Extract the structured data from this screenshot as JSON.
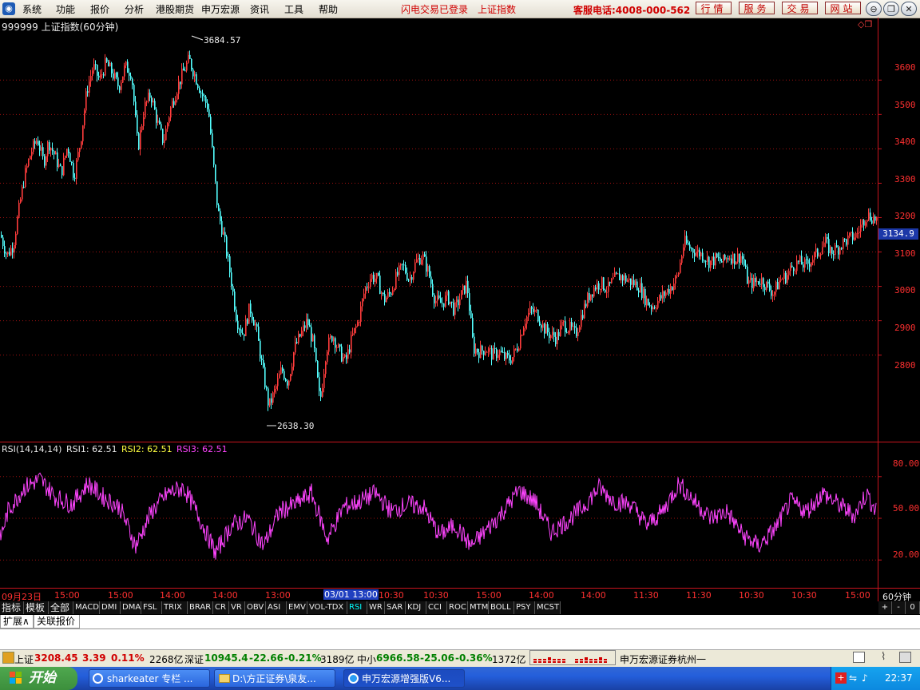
{
  "menu": {
    "items": [
      "系统",
      "功能",
      "报价",
      "分析",
      "港股期货",
      "申万宏源",
      "资讯",
      "工具",
      "帮助"
    ],
    "notice_login": "闪电交易已登录",
    "notice_index": "上证指数",
    "hotline": "客服电话:4008-000-562",
    "service_buttons": [
      "行情",
      "服务",
      "交易",
      "网站"
    ]
  },
  "chart_header": {
    "title": "999999 上证指数(60分钟)"
  },
  "main_axis": {
    "ticks": [
      "3600",
      "3500",
      "3400",
      "3300",
      "3200",
      "3100",
      "3000",
      "2900",
      "2800"
    ],
    "current_price": "3134.9"
  },
  "annotations": {
    "high": "3684.57",
    "low": "2638.30"
  },
  "indicator": {
    "name": "RSI(14,14,14)",
    "rsi1": "RSI1: 62.51",
    "rsi2": "RSI2: 62.51",
    "rsi3": "RSI3: 62.51",
    "ticks": [
      "80.00",
      "50.00",
      "20.00"
    ]
  },
  "time_axis": {
    "labels": [
      "09月23日",
      "15:00",
      "15:00",
      "14:00",
      "14:00",
      "13:00",
      "03/01 13:00",
      "10:30",
      "10:30",
      "15:00",
      "14:00",
      "14:00",
      "11:30",
      "11:30",
      "10:30",
      "10:30",
      "15:00"
    ],
    "period": "60分钟"
  },
  "indicator_tabs": [
    "指标",
    "模板",
    "全部",
    "MACD",
    "DMI",
    "DMA",
    "FSL",
    "TRIX",
    "BRAR",
    "CR",
    "VR",
    "OBV",
    "ASI",
    "EMV",
    "VOL-TDX",
    "RSI",
    "WR",
    "SAR",
    "KDJ",
    "CCI",
    "ROC",
    "MTM",
    "BOLL",
    "PSY",
    "MCST"
  ],
  "tab_controls": [
    "+",
    "-",
    "0"
  ],
  "extension_tabs": [
    "扩展∧",
    "关联报价"
  ],
  "status": {
    "sh_label": "上证",
    "sh_value": "3208.45",
    "sh_change": "3.39",
    "sh_pct": "0.11%",
    "sh_amount": "2268亿",
    "sz_label": "深证",
    "sz_value": "10945.4",
    "sz_change": "-22.66",
    "sz_pct": "-0.21%",
    "sz_amount": "3189亿",
    "zx_label": "中小",
    "zx_value": "6966.58",
    "zx_change": "-25.06",
    "zx_pct": "-0.36%",
    "zx_amount": "1372亿",
    "broker": "申万宏源证券杭州一"
  },
  "taskbar": {
    "start": "开始",
    "tasks": [
      "sharkeater 专栏 ...",
      "D:\\方正证券\\泉友...",
      "申万宏源增强版V6..."
    ],
    "clock": "22:37"
  },
  "colors": {
    "up": "#ff3c3c",
    "down": "#54ffff",
    "rsi": "#ff44ff",
    "grid": "#a01010",
    "axis": "#c8141e"
  },
  "chart_data": {
    "type": "candlestick",
    "title": "999999 上证指数(60分钟)",
    "y_range": [
      2560,
      3740
    ],
    "high": 3684.57,
    "low": 2638.3,
    "last": 3134.9,
    "close_path": [
      [
        0,
        3150
      ],
      [
        8,
        3090
      ],
      [
        16,
        3120
      ],
      [
        22,
        3210
      ],
      [
        30,
        3320
      ],
      [
        38,
        3390
      ],
      [
        46,
        3430
      ],
      [
        54,
        3360
      ],
      [
        60,
        3420
      ],
      [
        68,
        3380
      ],
      [
        76,
        3330
      ],
      [
        84,
        3410
      ],
      [
        92,
        3320
      ],
      [
        100,
        3420
      ],
      [
        108,
        3570
      ],
      [
        116,
        3640
      ],
      [
        124,
        3600
      ],
      [
        132,
        3650
      ],
      [
        140,
        3620
      ],
      [
        148,
        3580
      ],
      [
        156,
        3640
      ],
      [
        164,
        3620
      ],
      [
        172,
        3400
      ],
      [
        180,
        3520
      ],
      [
        188,
        3560
      ],
      [
        196,
        3480
      ],
      [
        204,
        3420
      ],
      [
        212,
        3510
      ],
      [
        220,
        3570
      ],
      [
        228,
        3620
      ],
      [
        236,
        3660
      ],
      [
        244,
        3610
      ],
      [
        252,
        3560
      ],
      [
        260,
        3520
      ],
      [
        266,
        3370
      ],
      [
        272,
        3220
      ],
      [
        280,
        3140
      ],
      [
        288,
        3030
      ],
      [
        296,
        2900
      ],
      [
        304,
        2860
      ],
      [
        312,
        2940
      ],
      [
        320,
        2880
      ],
      [
        328,
        2760
      ],
      [
        336,
        2650
      ],
      [
        344,
        2700
      ],
      [
        352,
        2760
      ],
      [
        360,
        2720
      ],
      [
        368,
        2820
      ],
      [
        376,
        2860
      ],
      [
        384,
        2900
      ],
      [
        392,
        2830
      ],
      [
        400,
        2660
      ],
      [
        408,
        2820
      ],
      [
        416,
        2860
      ],
      [
        424,
        2810
      ],
      [
        432,
        2780
      ],
      [
        440,
        2850
      ],
      [
        448,
        2900
      ],
      [
        456,
        2990
      ],
      [
        464,
        3030
      ],
      [
        472,
        3020
      ],
      [
        480,
        2960
      ],
      [
        488,
        2980
      ],
      [
        496,
        3030
      ],
      [
        504,
        3060
      ],
      [
        512,
        3020
      ],
      [
        520,
        3070
      ],
      [
        528,
        3090
      ],
      [
        536,
        3040
      ],
      [
        544,
        2960
      ],
      [
        552,
        2950
      ],
      [
        560,
        2970
      ],
      [
        568,
        2930
      ],
      [
        576,
        2970
      ],
      [
        584,
        3010
      ],
      [
        592,
        2820
      ],
      [
        600,
        2810
      ],
      [
        608,
        2820
      ],
      [
        616,
        2800
      ],
      [
        624,
        2810
      ],
      [
        632,
        2790
      ],
      [
        640,
        2790
      ],
      [
        648,
        2830
      ],
      [
        656,
        2900
      ],
      [
        664,
        2930
      ],
      [
        672,
        2920
      ],
      [
        680,
        2880
      ],
      [
        688,
        2860
      ],
      [
        696,
        2850
      ],
      [
        704,
        2890
      ],
      [
        712,
        2880
      ],
      [
        720,
        2860
      ],
      [
        728,
        2920
      ],
      [
        736,
        2970
      ],
      [
        744,
        3000
      ],
      [
        752,
        3010
      ],
      [
        760,
        2990
      ],
      [
        768,
        3020
      ],
      [
        776,
        3030
      ],
      [
        784,
        3020
      ],
      [
        792,
        3010
      ],
      [
        800,
        3000
      ],
      [
        808,
        2960
      ],
      [
        816,
        2940
      ],
      [
        824,
        2960
      ],
      [
        832,
        2980
      ],
      [
        840,
        3000
      ],
      [
        848,
        3030
      ],
      [
        856,
        3130
      ],
      [
        864,
        3110
      ],
      [
        872,
        3100
      ],
      [
        880,
        3090
      ],
      [
        888,
        3070
      ],
      [
        896,
        3080
      ],
      [
        904,
        3070
      ],
      [
        912,
        3090
      ],
      [
        920,
        3080
      ],
      [
        928,
        3090
      ],
      [
        936,
        3010
      ],
      [
        944,
        3010
      ],
      [
        952,
        3020
      ],
      [
        960,
        3000
      ],
      [
        968,
        2980
      ],
      [
        976,
        3020
      ],
      [
        984,
        3030
      ],
      [
        992,
        3060
      ],
      [
        1000,
        3070
      ],
      [
        1008,
        3060
      ],
      [
        1016,
        3080
      ],
      [
        1024,
        3100
      ],
      [
        1032,
        3130
      ],
      [
        1040,
        3100
      ],
      [
        1048,
        3110
      ],
      [
        1056,
        3130
      ],
      [
        1064,
        3140
      ],
      [
        1072,
        3150
      ],
      [
        1078,
        3180
      ],
      [
        1084,
        3210
      ],
      [
        1092,
        3200
      ],
      [
        1097,
        3195
      ]
    ]
  }
}
